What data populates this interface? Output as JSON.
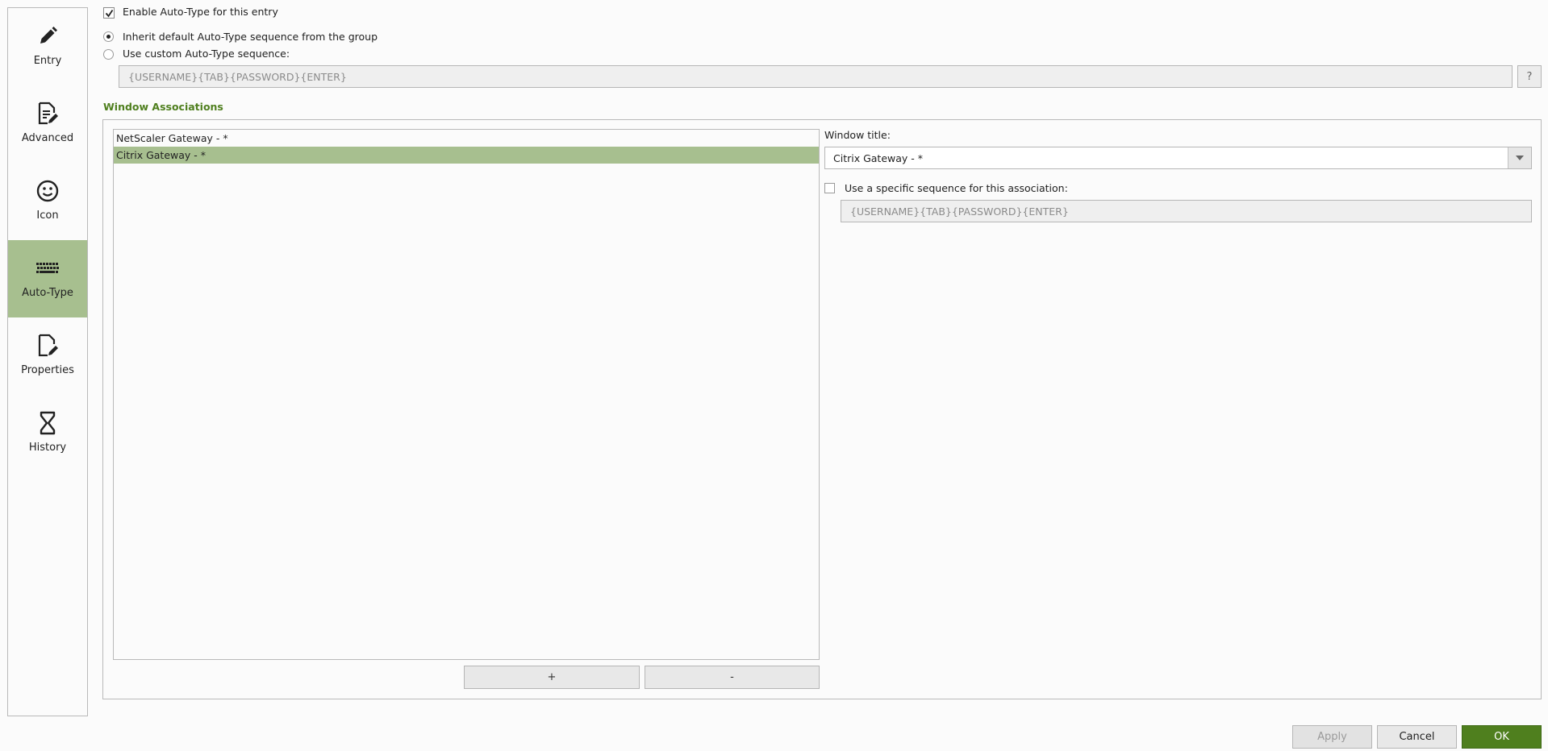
{
  "sidebar": {
    "items": [
      {
        "label": "Entry",
        "icon": "pencil-icon"
      },
      {
        "label": "Advanced",
        "icon": "document-edit-icon"
      },
      {
        "label": "Icon",
        "icon": "smiley-icon"
      },
      {
        "label": "Auto-Type",
        "icon": "keyboard-icon",
        "active": true
      },
      {
        "label": "Properties",
        "icon": "file-edit-icon"
      },
      {
        "label": "History",
        "icon": "hourglass-icon"
      }
    ]
  },
  "autotype": {
    "enable_label": "Enable Auto-Type for this entry",
    "enable_checked": true,
    "inherit_label": "Inherit default Auto-Type sequence from the group",
    "custom_label": "Use custom Auto-Type sequence:",
    "selected_option": "inherit",
    "custom_sequence_value": "{USERNAME}{TAB}{PASSWORD}{ENTER}",
    "help_button": "?"
  },
  "associations": {
    "heading": "Window Associations",
    "list": [
      {
        "title": "NetScaler Gateway - *",
        "selected": false
      },
      {
        "title": "Citrix Gateway - *",
        "selected": true
      }
    ],
    "add_button": "+",
    "remove_button": "-",
    "window_title_label": "Window title:",
    "window_title_value": "Citrix Gateway - *",
    "specific_sequence_label": "Use a specific sequence for this association:",
    "specific_sequence_checked": false,
    "specific_sequence_value": "{USERNAME}{TAB}{PASSWORD}{ENTER}"
  },
  "footer": {
    "apply": "Apply",
    "cancel": "Cancel",
    "ok": "OK"
  },
  "colors": {
    "accent_green": "#4f7f1e",
    "selection_green": "#a7bf8f",
    "heading_green": "#4f7f1e"
  }
}
